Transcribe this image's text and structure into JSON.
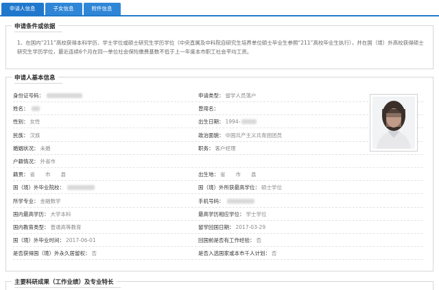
{
  "tabs": [
    {
      "label": "申请人信息",
      "active": true
    },
    {
      "label": "子女信息",
      "active": false
    },
    {
      "label": "附件信息",
      "active": false
    }
  ],
  "conditions": {
    "title": "申请条件或依据",
    "text": "1、在国内“211”高校获得本科学历、学士学位或硕士研究生学历学位（中央直属及中科院自研究生培养单位硕士毕业生参照“211”高校毕业生执行），并在国（境）外高校获得硕士研究生学历学位，最近连续6个月在同一单位社会保险缴费基数不低于上一年度本市职工社会平均工资。"
  },
  "basic": {
    "title": "申请人基本信息",
    "rows": [
      {
        "l1": "身份证号码：",
        "v1": "",
        "b1": 52,
        "l2": "申请类型：",
        "v2": "留学人员落户",
        "b2": 0
      },
      {
        "l1": "姓名：",
        "v1": "",
        "b1": 12,
        "l2": "曾用名：",
        "v2": "",
        "b2": 0
      },
      {
        "l1": "性别：",
        "v1": "女性",
        "b1": 0,
        "l2": "出生日期：",
        "v2": "1994-",
        "b2": 22
      },
      {
        "l1": "民族：",
        "v1": "汉族",
        "b1": 0,
        "l2": "政治面貌：",
        "v2": "中国共产主义共青团团员",
        "b2": 0
      },
      {
        "l1": "婚姻状况：",
        "v1": "未婚",
        "b1": 0,
        "l2": "职务：",
        "v2": "客户经理",
        "b2": 0
      },
      {
        "l1": "户籍情况：",
        "v1": "外省市",
        "b1": 0,
        "l2": "",
        "v2": "",
        "b2": 0
      },
      {
        "l1": "籍贯：",
        "v1": "省　　市　　县",
        "b1": 0,
        "l2": "出生地：",
        "v2": "省　　市　　县",
        "b2": 0
      },
      {
        "l1": "国（境）外毕业院校：",
        "v1": "",
        "b1": 40,
        "l2": "国（境）外所获最高学位：",
        "v2": "硕士学位",
        "b2": 0
      },
      {
        "l1": "所学专业：",
        "v1": "金融数学",
        "b1": 0,
        "l2": "手机号码：",
        "v2": "",
        "b2": 40
      },
      {
        "l1": "国内最高学历：",
        "v1": "大学本科",
        "b1": 0,
        "l2": "最高学历相应学位：",
        "v2": "学士学位",
        "b2": 0
      },
      {
        "l1": "国内教育类型：",
        "v1": "普通高等教育",
        "b1": 0,
        "l2": "留学回国日期：",
        "v2": "2017-03-29",
        "b2": 0
      },
      {
        "l1": "国（境）外毕业时间：",
        "v1": "2017-06-01",
        "b1": 0,
        "l2": "回国前是否有工作经验：",
        "v2": "否",
        "b2": 0
      },
      {
        "l1": "是否获得国（境）外永久居留权：",
        "v1": "否",
        "b1": 0,
        "l2": "是否入选国家或本市千人计划：",
        "v2": "否",
        "b2": 0
      }
    ]
  },
  "achievements": {
    "title": "主要科研成果（工作业绩）及专业特长"
  }
}
